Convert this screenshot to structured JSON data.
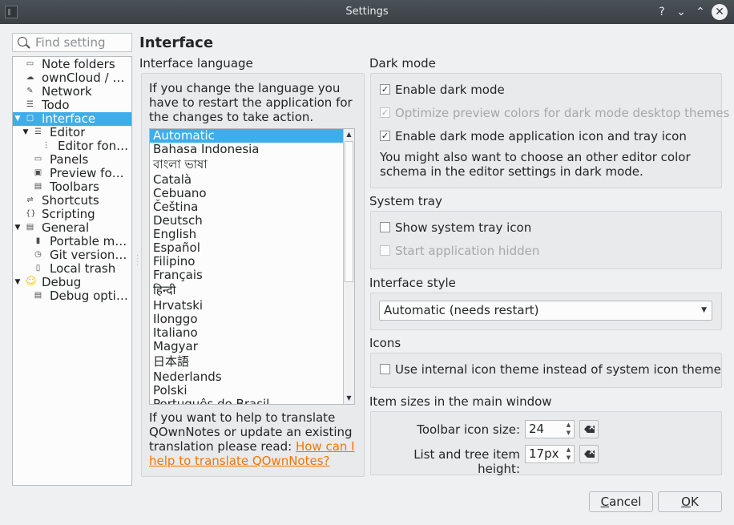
{
  "window": {
    "title": "Settings",
    "help": "?",
    "minimize": "⌄",
    "maximize": "⌃",
    "close": "✕"
  },
  "search": {
    "placeholder": "Find setting"
  },
  "tree": [
    {
      "label": "Note folders",
      "icon": "folder-icon",
      "glyph": "▭"
    },
    {
      "label": "ownCloud / …",
      "icon": "cloud-icon",
      "glyph": "☁"
    },
    {
      "label": "Network",
      "icon": "network-icon",
      "glyph": "✎"
    },
    {
      "label": "Todo",
      "icon": "todo-icon",
      "glyph": "☰"
    },
    {
      "label": "Interface",
      "icon": "interface-icon",
      "glyph": "▢",
      "selected": true,
      "expanded": true
    },
    {
      "label": "Editor",
      "icon": "editor-icon",
      "glyph": "☰",
      "expanded": true
    },
    {
      "label": "Editor font…",
      "icon": "font-icon",
      "glyph": "⋮"
    },
    {
      "label": "Panels",
      "icon": "panels-icon",
      "glyph": "▭"
    },
    {
      "label": "Preview fonts",
      "icon": "preview-icon",
      "glyph": "▣"
    },
    {
      "label": "Toolbars",
      "icon": "toolbars-icon",
      "glyph": "▤"
    },
    {
      "label": "Shortcuts",
      "icon": "shortcuts-icon",
      "glyph": "⇌"
    },
    {
      "label": "Scripting",
      "icon": "scripting-icon",
      "glyph": "{}"
    },
    {
      "label": "General",
      "icon": "general-icon",
      "glyph": "▤",
      "expanded": true
    },
    {
      "label": "Portable m…",
      "icon": "portable-icon",
      "glyph": "▮"
    },
    {
      "label": "Git versioning",
      "icon": "clock-icon",
      "glyph": "◷"
    },
    {
      "label": "Local trash",
      "icon": "trash-icon",
      "glyph": "▯"
    },
    {
      "label": "Debug",
      "icon": "debug-icon",
      "glyph": "☺",
      "expanded": true
    },
    {
      "label": "Debug opti…",
      "icon": "debug-options-icon",
      "glyph": "▤"
    }
  ],
  "page_title": "Interface",
  "language": {
    "heading": "Interface language",
    "info": "If you change the language you have to restart the application for the changes to take action.",
    "items": [
      "Automatic",
      "Bahasa Indonesia",
      "বাংলা ভাষা",
      "Català",
      "Cebuano",
      "Čeština",
      "Deutsch",
      "English",
      "Español",
      "Filipino",
      "Français",
      "हिन्दी",
      "Hrvatski",
      "Ilonggo",
      "Italiano",
      "Magyar",
      "日本語",
      "Nederlands",
      "Polski",
      "Português do Brasil"
    ],
    "selected": "Automatic",
    "translate_text": "If you want to help to translate QOwnNotes or update an existing translation please read: ",
    "translate_link": "How can I help to translate QOwnNotes?"
  },
  "dark_mode": {
    "heading": "Dark mode",
    "enable": {
      "label": "Enable dark mode",
      "checked": true
    },
    "optimize": {
      "label": "Optimize preview colors for dark mode desktop themes",
      "checked": true,
      "disabled": true
    },
    "tray_icon": {
      "label": "Enable dark mode application icon and tray icon",
      "checked": true
    },
    "note": "You might also want to choose an other editor color schema in the editor settings in dark mode."
  },
  "system_tray": {
    "heading": "System tray",
    "show": {
      "label": "Show system tray icon",
      "checked": false
    },
    "hidden": {
      "label": "Start application hidden",
      "checked": false,
      "disabled": true
    }
  },
  "interface_style": {
    "heading": "Interface style",
    "value": "Automatic (needs restart)"
  },
  "icons": {
    "heading": "Icons",
    "internal": {
      "label": "Use internal icon theme instead of system icon theme",
      "checked": false
    }
  },
  "item_sizes": {
    "heading": "Item sizes in the main window",
    "toolbar_label": "Toolbar icon size:",
    "toolbar_value": "24",
    "tree_label": "List and tree item height:",
    "tree_value": "17px"
  },
  "buttons": {
    "cancel_u": "C",
    "cancel_rest": "ancel",
    "ok_u": "O",
    "ok_rest": "K"
  },
  "colors": {
    "accent": "#3daee9",
    "link": "#f67400",
    "titlebar": "#3b4045"
  }
}
